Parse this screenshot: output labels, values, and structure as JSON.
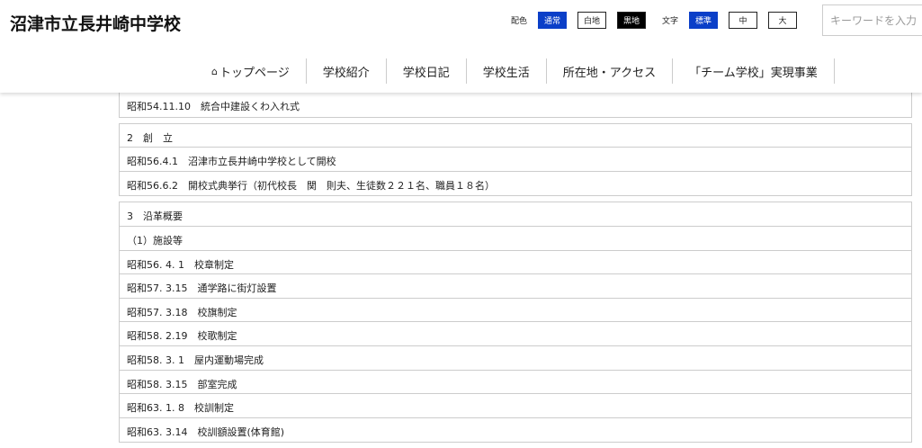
{
  "site_title": "沼津市立長井崎中学校",
  "color_label": "配色",
  "color_options": [
    "通常",
    "白地",
    "黒地"
  ],
  "text_label": "文字",
  "text_options": [
    "標準",
    "中",
    "大"
  ],
  "search_placeholder": "キーワードを入力",
  "nav": [
    "トップページ",
    "学校紹介",
    "学校日記",
    "学校生活",
    "所在地・アクセス",
    "「チーム学校」実現事業"
  ],
  "tables": [
    [
      "昭和54.11.10　統合中建設くわ入れ式"
    ],
    [
      "2　創　立",
      "昭和56.4.1　沼津市立長井崎中学校として開校",
      "昭和56.6.2　開校式典挙行（初代校長　関　則夫、生徒数２２１名、職員１８名）"
    ],
    [
      "3　沿革概要",
      "（1）施設等",
      "昭和56. 4. 1　校章制定",
      "昭和57. 3.15　通学路に街灯設置",
      "昭和57. 3.18　校旗制定",
      "昭和58. 2.19　校歌制定",
      "昭和58. 3. 1　屋内運動場完成",
      "昭和58. 3.15　部室完成",
      "昭和63. 1. 8　校訓制定",
      "昭和63. 3.14　校訓額設置(体育館)"
    ]
  ]
}
